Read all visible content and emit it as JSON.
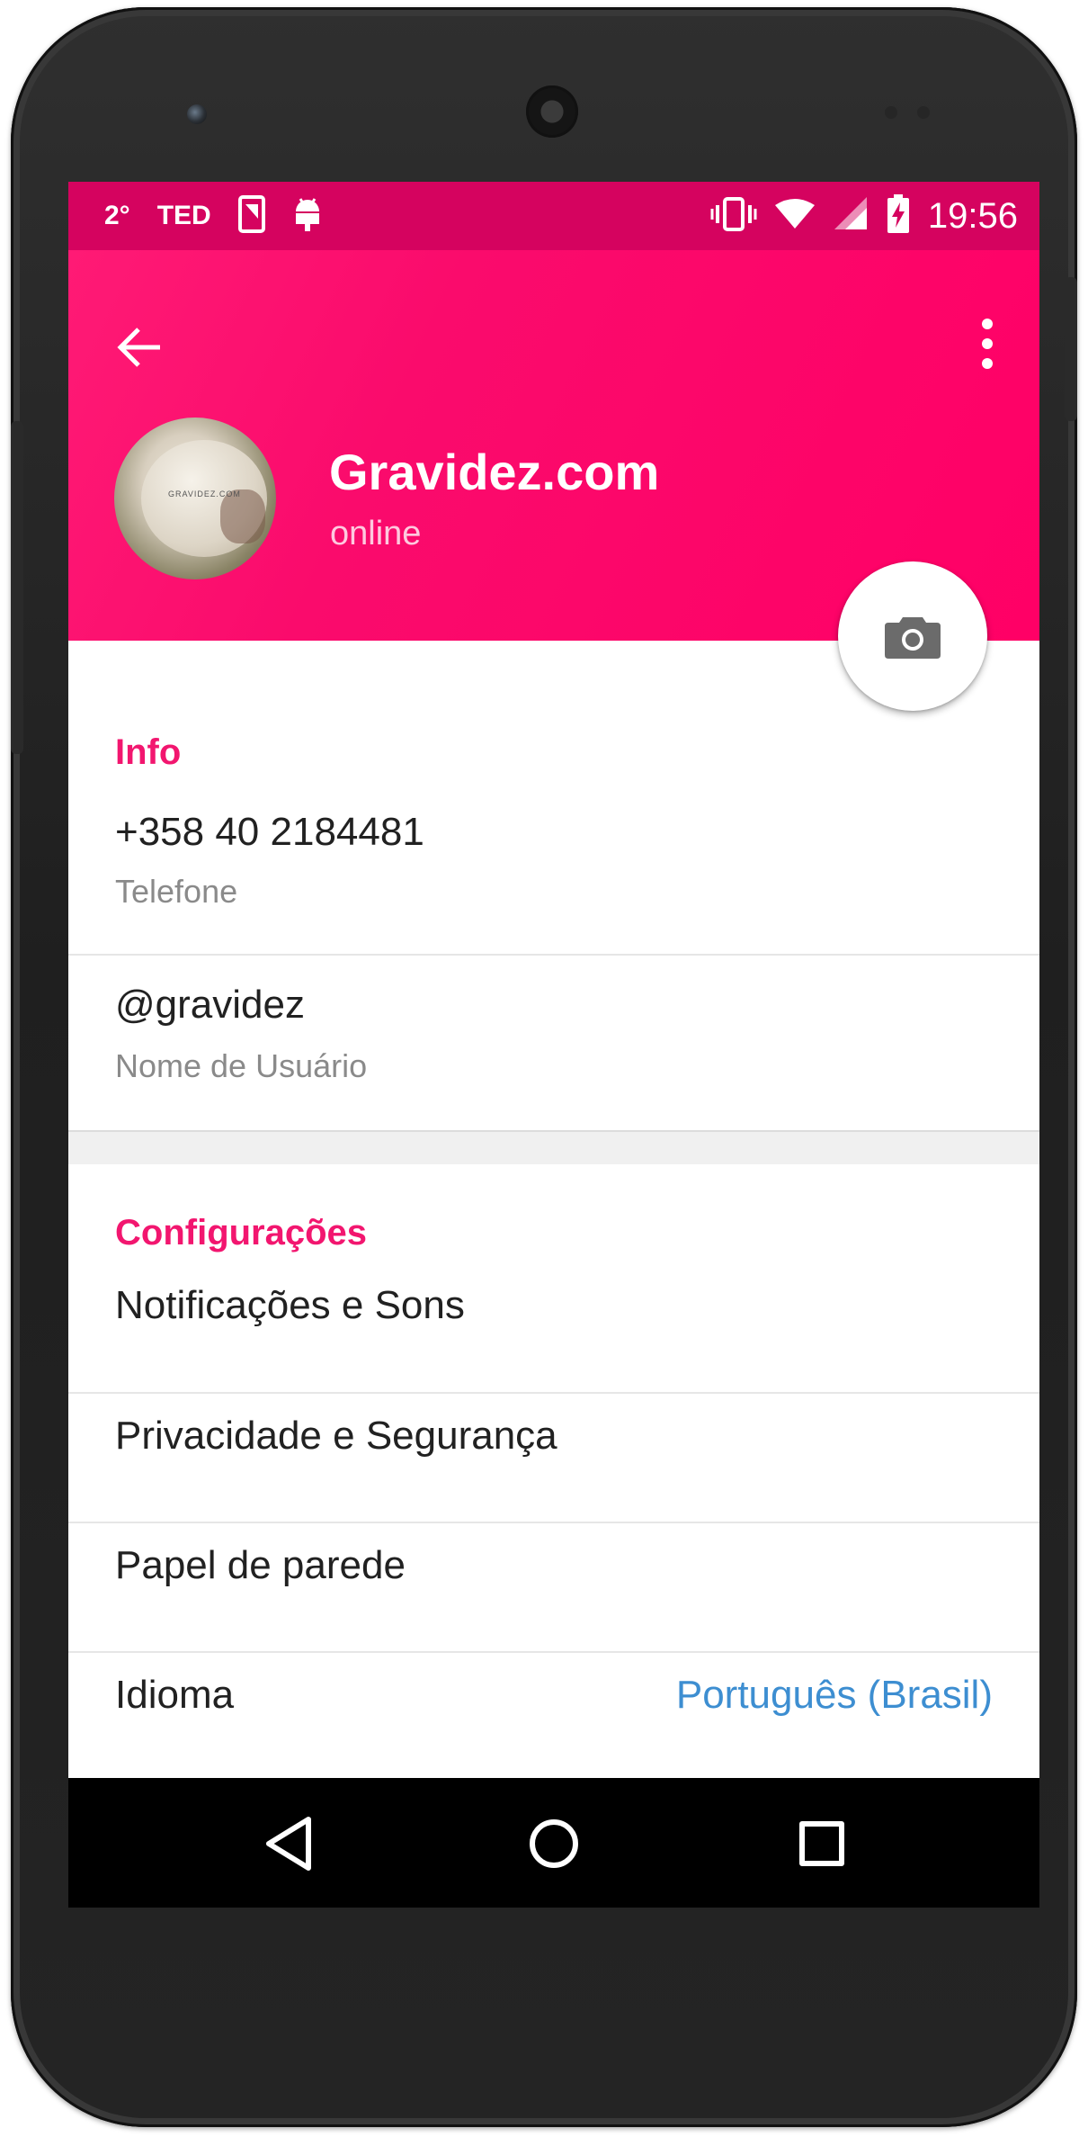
{
  "status_bar": {
    "temp": "2°",
    "ted": "TED",
    "time": "19:56",
    "icons": [
      "phone-outline-icon",
      "android-icon",
      "vibrate-icon",
      "wifi-icon",
      "signal-icon",
      "battery-charging-icon"
    ]
  },
  "app_bar": {
    "back_icon": "arrow-back-icon",
    "menu_icon": "more-vert-icon"
  },
  "profile": {
    "name": "Gravidez.com",
    "status": "online",
    "avatar_text": "GRAVIDEZ.COM"
  },
  "fab": {
    "icon": "camera-icon"
  },
  "info": {
    "title": "Info",
    "phone": {
      "value": "+358 40 2184481",
      "label": "Telefone"
    },
    "username": {
      "value": "@gravidez",
      "label": "Nome de Usuário"
    }
  },
  "settings": {
    "title": "Configurações",
    "items": [
      {
        "label": "Notificações e Sons"
      },
      {
        "label": "Privacidade e Segurança"
      },
      {
        "label": "Papel de parede"
      },
      {
        "label": "Idioma",
        "value": "Português (Brasil)"
      }
    ]
  },
  "nav_bar": {
    "icons": [
      "nav-back-icon",
      "nav-home-icon",
      "nav-recents-icon"
    ]
  },
  "colors": {
    "accent": "#f2166f",
    "app_bar": "#ff0a6e",
    "status_bar": "#d5035f",
    "link": "#3d8ed1"
  }
}
